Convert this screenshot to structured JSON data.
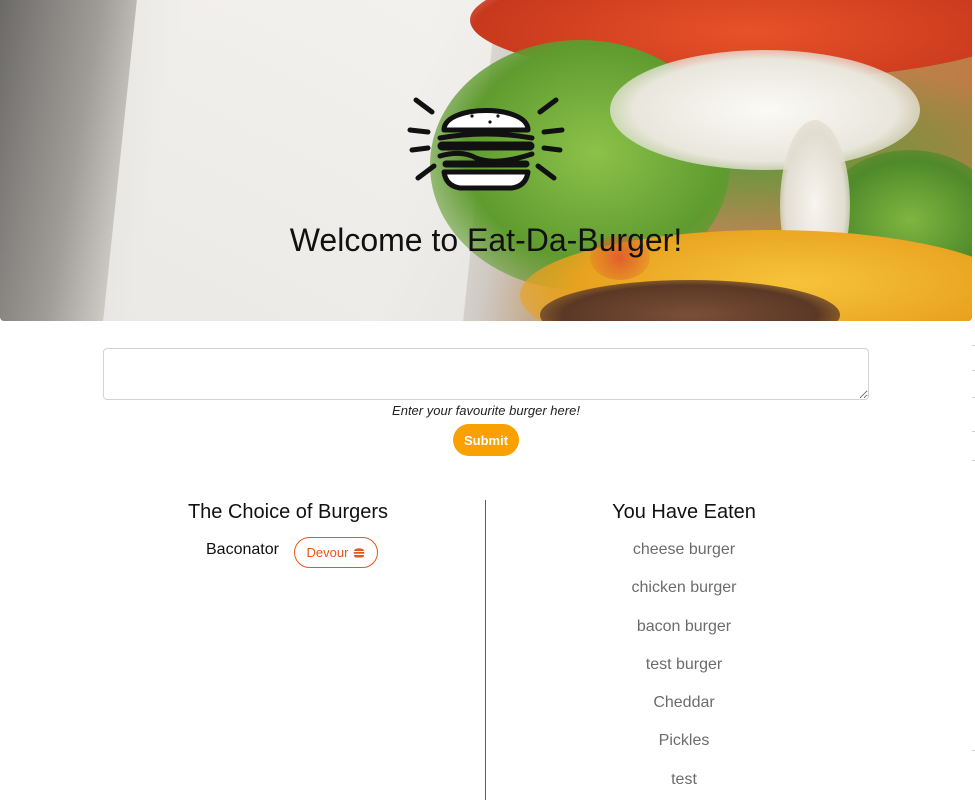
{
  "header": {
    "title": "Welcome to Eat-Da-Burger!",
    "logo_icon": "burger-icon"
  },
  "form": {
    "input_value": "",
    "input_placeholder": "",
    "hint": "Enter your favourite burger here!",
    "submit_label": "Submit"
  },
  "choices": {
    "title": "The Choice of Burgers",
    "items": [
      {
        "name": "Baconator",
        "button_label": "Devour",
        "button_icon": "hamburger-icon"
      }
    ]
  },
  "eaten": {
    "title": "You Have Eaten",
    "items": [
      "cheese burger",
      "chicken burger",
      "bacon burger",
      "test burger",
      "Cheddar",
      "Pickles",
      "test"
    ]
  },
  "colors": {
    "submit": "#f8a100",
    "devour": "#e8551c",
    "divider": "#c0392b",
    "eaten_text": "#6c6c6c"
  }
}
